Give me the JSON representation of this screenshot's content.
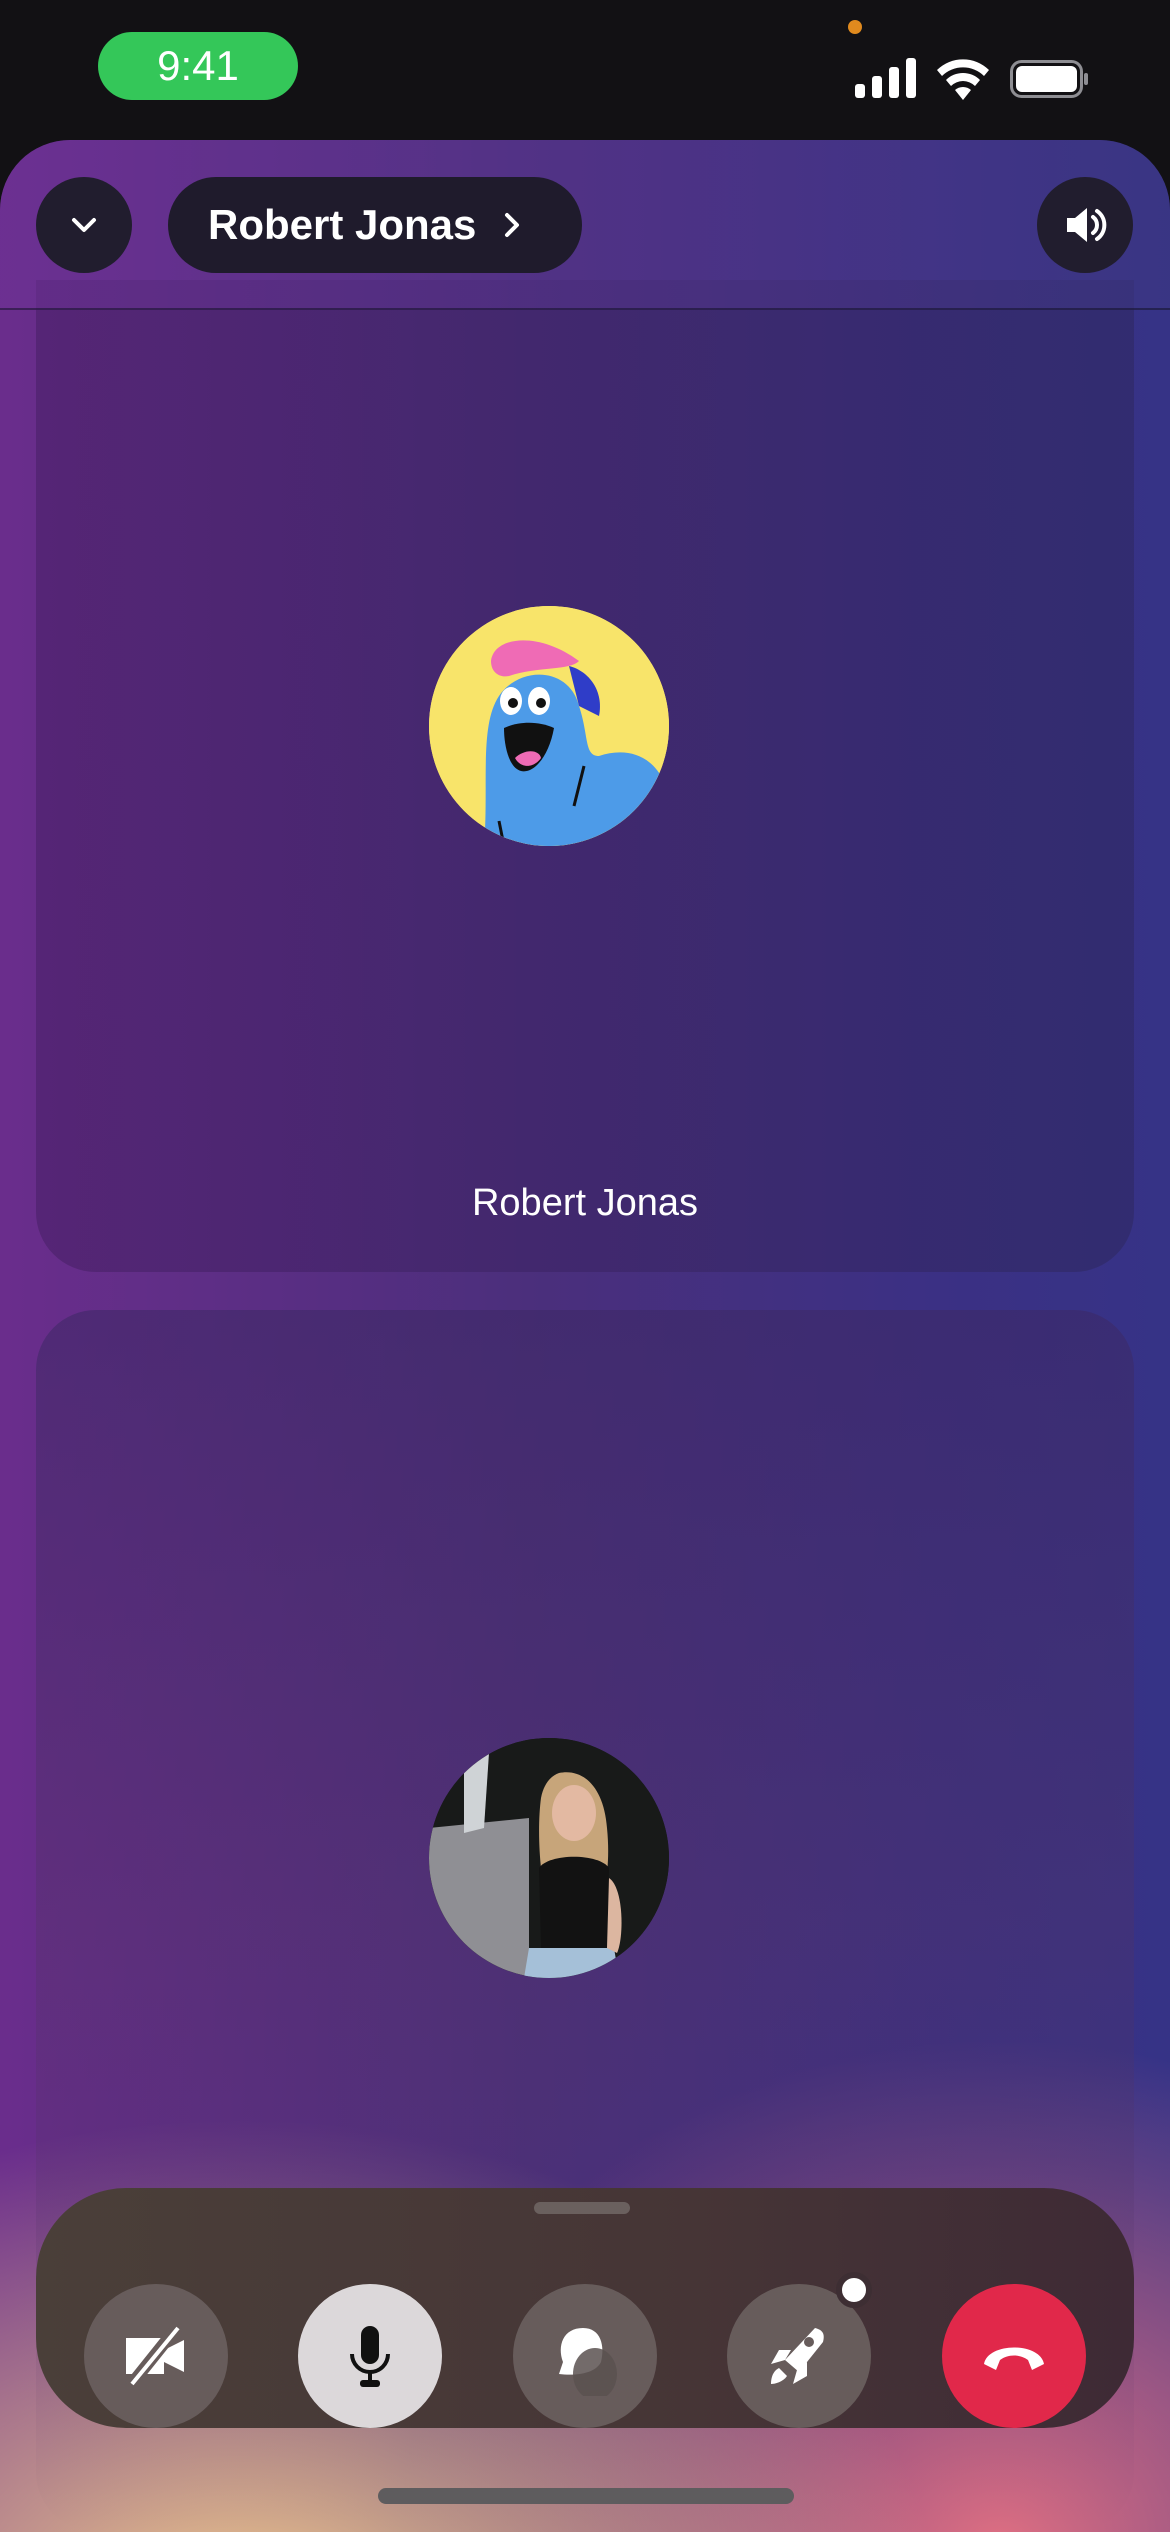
{
  "status_bar": {
    "time": "9:41",
    "icons": [
      "cellular-signal-icon",
      "wifi-icon",
      "battery-icon"
    ],
    "privacy_indicator_color": "#e08a1e",
    "time_pill_color": "#34c759"
  },
  "header": {
    "collapse_icon": "chevron-down-icon",
    "caller_name": "Robert Jonas",
    "name_chevron_icon": "chevron-right-icon",
    "speaker_icon": "speaker-wave-icon"
  },
  "participants": [
    {
      "name": "Robert Jonas",
      "avatar": "cartoon-blue-character-avatar"
    },
    {
      "name": "",
      "avatar": "photo-woman-avatar"
    }
  ],
  "controls": [
    {
      "id": "camera",
      "icon": "video-off-icon",
      "state": "off"
    },
    {
      "id": "mic",
      "icon": "microphone-icon",
      "state": "on"
    },
    {
      "id": "chat",
      "icon": "chat-bubble-icon",
      "state": "default"
    },
    {
      "id": "activities",
      "icon": "rocket-icon",
      "state": "default",
      "has_badge": true
    },
    {
      "id": "end-call",
      "icon": "hang-up-icon",
      "state": "danger"
    }
  ],
  "colors": {
    "end_call": "#e1284a",
    "mic_active_bg": "#dcd8da",
    "control_bg": "#675c5b"
  }
}
